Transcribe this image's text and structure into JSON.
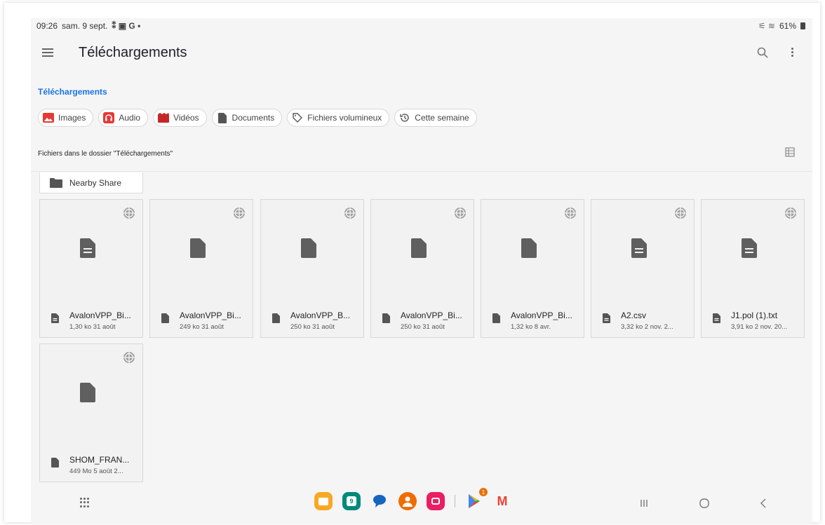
{
  "status": {
    "time": "09:26",
    "date": "sam. 9 sept.",
    "battery": "61%"
  },
  "header": {
    "title": "Téléchargements"
  },
  "breadcrumb": "Téléchargements",
  "chips": [
    {
      "label": "Images",
      "icon": "image-icon",
      "color": "#e53935"
    },
    {
      "label": "Audio",
      "icon": "headphones-icon",
      "color": "#e53935"
    },
    {
      "label": "Vidéos",
      "icon": "video-icon",
      "color": "#c62828"
    },
    {
      "label": "Documents",
      "icon": "document-icon",
      "color": "#555555"
    },
    {
      "label": "Fichiers volumineux",
      "icon": "tag-icon",
      "color": "#555555"
    },
    {
      "label": "Cette semaine",
      "icon": "history-icon",
      "color": "#555555"
    }
  ],
  "folder_caption": "Fichiers dans le dossier \"Téléchargements\"",
  "folder": {
    "name": "Nearby Share"
  },
  "files": [
    {
      "name": "AvalonVPP_Bi...",
      "meta": "1,30 ko 31 août",
      "kind": "text"
    },
    {
      "name": "AvalonVPP_Bi...",
      "meta": "249 ko 31 août",
      "kind": "file"
    },
    {
      "name": "AvalonVPP_B...",
      "meta": "250 ko 31 août",
      "kind": "file"
    },
    {
      "name": "AvalonVPP_Bi...",
      "meta": "250 ko 31 août",
      "kind": "file"
    },
    {
      "name": "AvalonVPP_Bi...",
      "meta": "1,32 ko 8 avr.",
      "kind": "file"
    },
    {
      "name": "A2.csv",
      "meta": "3,32 ko 2 nov. 2...",
      "kind": "text"
    },
    {
      "name": "J1.pol (1).txt",
      "meta": "3,91 ko 2 nov. 20...",
      "kind": "text"
    },
    {
      "name": "SHOM_FRAN...",
      "meta": "449 Mo 5 août 2...",
      "kind": "file"
    }
  ],
  "dock": [
    {
      "name": "files-app",
      "color": "#f9a825"
    },
    {
      "name": "calendar-app",
      "color": "#00897b",
      "text": "9"
    },
    {
      "name": "messages-app",
      "color": "#1565c0"
    },
    {
      "name": "contacts-app",
      "color": "#ef6c00"
    },
    {
      "name": "screen-recorder-app",
      "color": "#e91e63"
    },
    {
      "name": "play-store-app",
      "color": "#34a853",
      "badge": "1"
    },
    {
      "name": "gmail-app",
      "color": "#ea4335",
      "text": "M"
    }
  ]
}
